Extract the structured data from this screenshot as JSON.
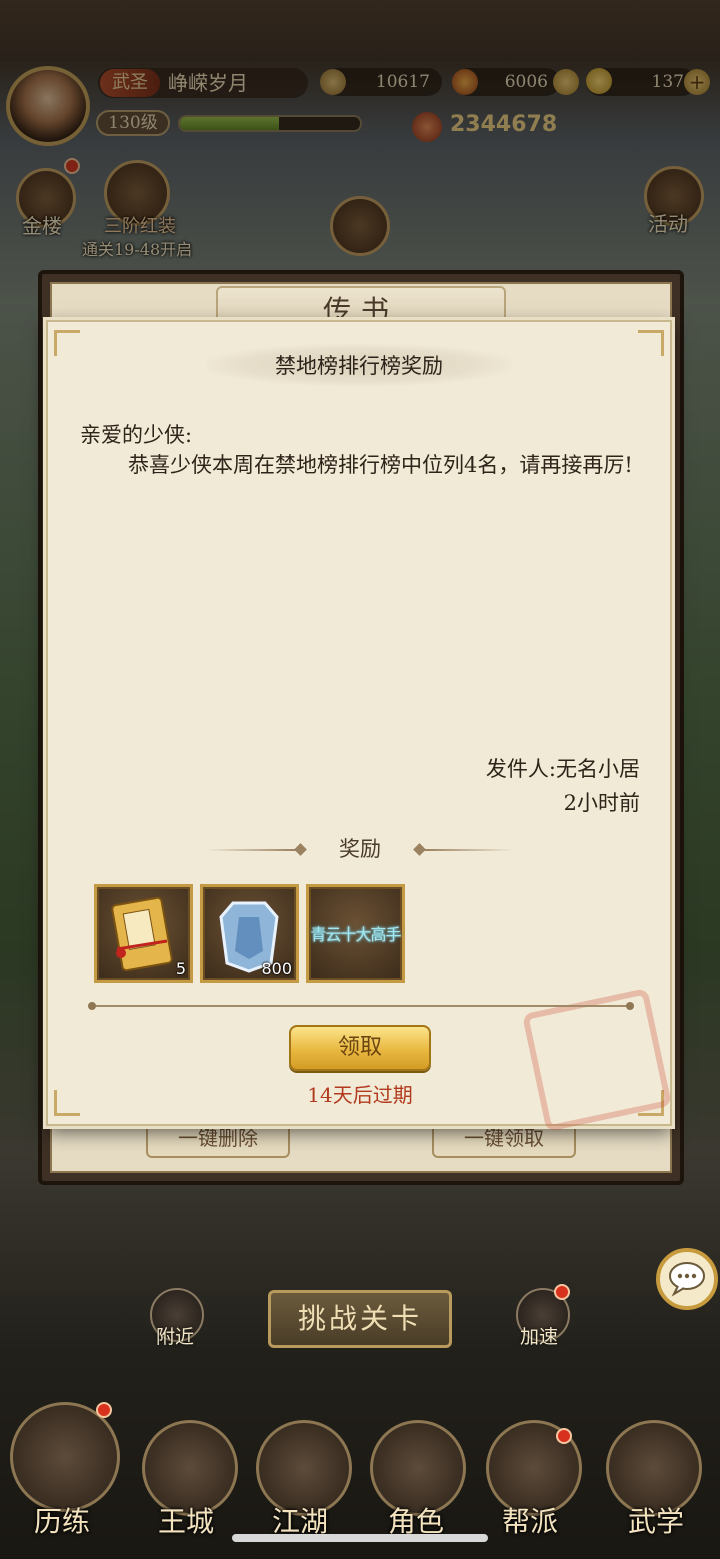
{
  "player": {
    "title_tag": "武圣",
    "name": "峥嵘岁月",
    "level": "130级",
    "exp_fraction": 0.55,
    "power": "2344678"
  },
  "resources": [
    {
      "icon": "copper-coin-icon",
      "value": "10617"
    },
    {
      "icon": "ingot-icon",
      "value": "6006"
    },
    {
      "icon": "gold-ingot-icon",
      "value": "137"
    }
  ],
  "side_left": [
    {
      "label": "金楼"
    },
    {
      "label": "三阶红装"
    },
    {
      "label": "通关19-48开启"
    }
  ],
  "side_right": {
    "label": "活动"
  },
  "outer_panel": {
    "title": "传书",
    "delete_all": "一键删除",
    "claim_all": "一键领取"
  },
  "letter": {
    "title": "禁地榜排行榜奖励",
    "greeting": "亲爱的少侠:",
    "body": "恭喜少侠本周在禁地榜排行榜中位列4名，请再接再厉!",
    "sender": "发件人:无名小居",
    "time": "2小时前",
    "reward_title": "奖励",
    "items": [
      {
        "icon": "skill-book-icon",
        "count": "5"
      },
      {
        "icon": "armor-plate-icon",
        "count": "800"
      },
      {
        "icon": "title-banner-icon",
        "count": "",
        "text": "青云十大高手"
      }
    ],
    "claim_label": "领取",
    "expire": "14天后过期"
  },
  "bottom": {
    "nearby": "附近",
    "challenge": "挑战关卡",
    "speedup": "加速",
    "nav": [
      {
        "label": "历练"
      },
      {
        "label": "王城"
      },
      {
        "label": "江湖"
      },
      {
        "label": "角色"
      },
      {
        "label": "帮派"
      },
      {
        "label": "武学"
      }
    ]
  }
}
